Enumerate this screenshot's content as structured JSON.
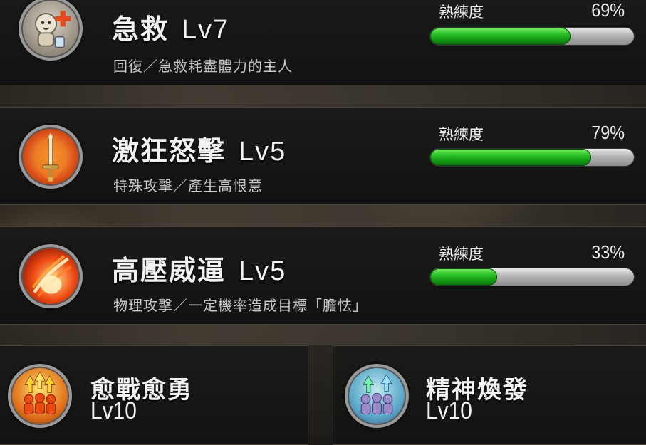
{
  "skills": [
    {
      "name": "急救",
      "level": "Lv7",
      "description": "回復／急救耗盡體力的主人",
      "proficiency_label": "熟練度",
      "proficiency_pct": "69%",
      "proficiency_value": 69,
      "icon": "first-aid-icon"
    },
    {
      "name": "激狂怒擊",
      "level": "Lv5",
      "description": "特殊攻擊／產生高恨意",
      "proficiency_label": "熟練度",
      "proficiency_pct": "79%",
      "proficiency_value": 79,
      "icon": "flaming-sword-icon"
    },
    {
      "name": "高壓威逼",
      "level": "Lv5",
      "description": "物理攻擊／一定機率造成目標「膽怯」",
      "proficiency_label": "熟練度",
      "proficiency_pct": "33%",
      "proficiency_value": 33,
      "icon": "fire-slash-icon"
    }
  ],
  "passives": [
    {
      "name": "愈戰愈勇",
      "level": "Lv10",
      "icon": "party-power-up-icon"
    },
    {
      "name": "精神煥發",
      "level": "Lv10",
      "icon": "party-spirit-up-icon"
    }
  ],
  "colors": {
    "bar_fill": "#1fae1c",
    "bar_track": "#b4b4b4",
    "card_border": "#4a4234",
    "text": "#f2f2f2"
  }
}
